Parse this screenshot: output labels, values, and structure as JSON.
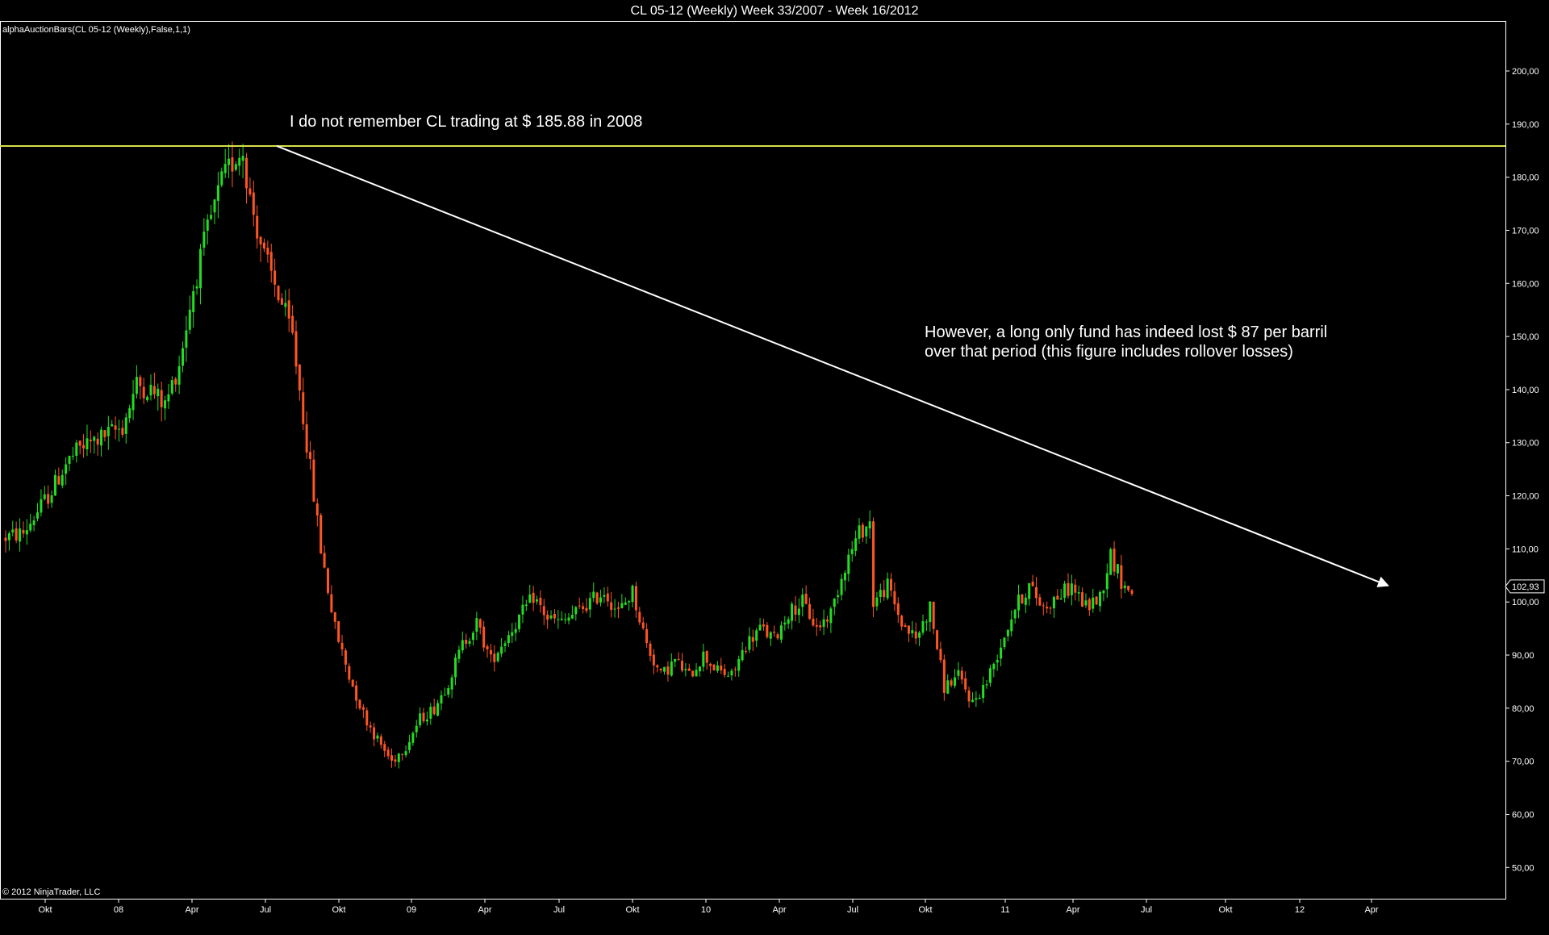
{
  "title": "CL 05-12 (Weekly)  Week 33/2007 - Week 16/2012",
  "indicator_label": "alphaAuctionBars(CL 05-12 (Weekly),False,1,1)",
  "copyright": "© 2012 NinjaTrader, LLC",
  "annotations": [
    {
      "text": "I do not remember CL trading at $ 185.88 in 2008"
    },
    {
      "lines": [
        "However, a long only fund has indeed lost $ 87 per barril",
        "over that period (this figure includes rollover losses)"
      ]
    }
  ],
  "colors": {
    "background": "#000000",
    "up_bar": "#22dd22",
    "down_bar": "#ff5522",
    "horizontal_line": "#d8e04a",
    "trend_arrow": "#ffffff",
    "axis": "#ffffff"
  },
  "chart_data": {
    "type": "candlestick",
    "ylim": [
      45,
      205
    ],
    "y_ticks": [
      "200,00",
      "190,00",
      "180,00",
      "170,00",
      "160,00",
      "150,00",
      "140,00",
      "130,00",
      "120,00",
      "110,00",
      "100,00",
      "90,00",
      "80,00",
      "70,00",
      "60,00",
      "50,00"
    ],
    "y_tick_values": [
      200,
      190,
      180,
      170,
      160,
      150,
      140,
      130,
      120,
      110,
      100,
      90,
      80,
      70,
      60,
      50
    ],
    "x_ticks": [
      "Okt",
      "08",
      "Apr",
      "Jul",
      "Okt",
      "09",
      "Apr",
      "Jul",
      "Okt",
      "10",
      "Apr",
      "Jul",
      "Okt",
      "11",
      "Apr",
      "Jul",
      "Okt",
      "12",
      "Apr"
    ],
    "last_price": "102,93",
    "last_price_value": 102.93,
    "horizontal_line_value": 185.88,
    "trend_arrow": {
      "from": 185.88,
      "to": 103.0
    },
    "anchors": [
      [
        0,
        112
      ],
      [
        6,
        113
      ],
      [
        10,
        117
      ],
      [
        14,
        121
      ],
      [
        18,
        126
      ],
      [
        22,
        129
      ],
      [
        28,
        131
      ],
      [
        34,
        133
      ],
      [
        38,
        141
      ],
      [
        42,
        140
      ],
      [
        46,
        137
      ],
      [
        50,
        145
      ],
      [
        54,
        159
      ],
      [
        58,
        170
      ],
      [
        62,
        179
      ],
      [
        66,
        184
      ],
      [
        68,
        185
      ],
      [
        70,
        176
      ],
      [
        74,
        165
      ],
      [
        78,
        158
      ],
      [
        82,
        150
      ],
      [
        86,
        130
      ],
      [
        90,
        110
      ],
      [
        94,
        95
      ],
      [
        98,
        86
      ],
      [
        102,
        79
      ],
      [
        106,
        74
      ],
      [
        110,
        70
      ],
      [
        114,
        73
      ],
      [
        118,
        78
      ],
      [
        122,
        80
      ],
      [
        126,
        85
      ],
      [
        130,
        92
      ],
      [
        134,
        96
      ],
      [
        138,
        89
      ],
      [
        142,
        93
      ],
      [
        146,
        97
      ],
      [
        150,
        101
      ],
      [
        154,
        97
      ],
      [
        158,
        96
      ],
      [
        162,
        98
      ],
      [
        166,
        100
      ],
      [
        170,
        102
      ],
      [
        174,
        98
      ],
      [
        178,
        102
      ],
      [
        182,
        92
      ],
      [
        186,
        86
      ],
      [
        190,
        89
      ],
      [
        194,
        86
      ],
      [
        198,
        90
      ],
      [
        202,
        87
      ],
      [
        206,
        86
      ],
      [
        210,
        92
      ],
      [
        214,
        95
      ],
      [
        218,
        93
      ],
      [
        222,
        98
      ],
      [
        226,
        100
      ],
      [
        230,
        95
      ],
      [
        234,
        98
      ],
      [
        238,
        107
      ],
      [
        242,
        113
      ],
      [
        245,
        115
      ],
      [
        246,
        100
      ],
      [
        250,
        103
      ],
      [
        254,
        96
      ],
      [
        258,
        93
      ],
      [
        262,
        99
      ],
      [
        266,
        84
      ],
      [
        270,
        86
      ],
      [
        274,
        81
      ],
      [
        278,
        85
      ],
      [
        282,
        92
      ],
      [
        286,
        99
      ],
      [
        290,
        103
      ],
      [
        294,
        99
      ],
      [
        298,
        101
      ],
      [
        302,
        103
      ],
      [
        306,
        99
      ],
      [
        310,
        101
      ],
      [
        313,
        109
      ],
      [
        316,
        104
      ],
      [
        318,
        102
      ]
    ]
  }
}
